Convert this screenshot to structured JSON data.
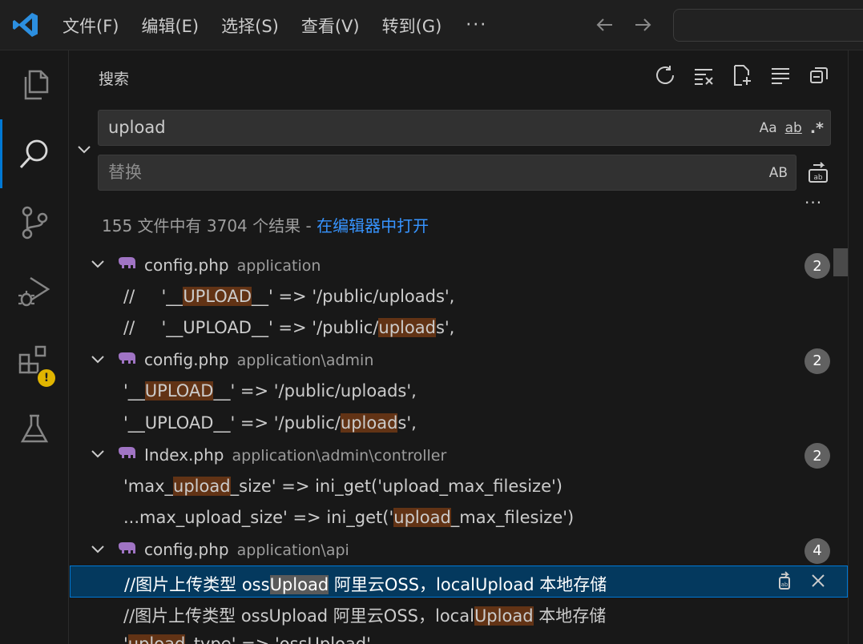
{
  "menu": {
    "items": [
      "文件(F)",
      "编辑(E)",
      "选择(S)",
      "查看(V)",
      "转到(G)"
    ],
    "more": "···"
  },
  "activity": {
    "items": [
      "files-icon",
      "search-icon",
      "source-control-icon",
      "run-debug-icon",
      "extensions-icon",
      "testing-icon"
    ],
    "warning_badge": "!"
  },
  "panel": {
    "title": "搜索",
    "search_value": "upload",
    "search_opts": [
      "Aa",
      "ab",
      ".*"
    ],
    "replace_placeholder": "替换",
    "replace_opt": "AB",
    "more": "···",
    "summary_text": "155 文件中有 3704 个结果 - ",
    "summary_link": "在编辑器中打开"
  },
  "results": [
    {
      "name": "config.php",
      "path": "application",
      "count": "2",
      "matches": [
        [
          "//     '__",
          "UPLOAD",
          "__' => '/public/uploads',"
        ],
        [
          "//     '__UPLOAD__' => '/public/",
          "upload",
          "s',"
        ]
      ]
    },
    {
      "name": "config.php",
      "path": "application\\admin",
      "count": "2",
      "matches": [
        [
          "'__",
          "UPLOAD",
          "__' => '/public/uploads',"
        ],
        [
          "'__UPLOAD__' => '/public/",
          "upload",
          "s',"
        ]
      ]
    },
    {
      "name": "Index.php",
      "path": "application\\admin\\controller",
      "count": "2",
      "matches": [
        [
          "'max_",
          "upload",
          "_size' => ini_get('upload_max_filesize')"
        ],
        [
          "...max_upload_size' => ini_get('",
          "upload",
          "_max_filesize')"
        ]
      ]
    },
    {
      "name": "config.php",
      "path": "application\\api",
      "count": "4",
      "matches": [
        [
          "//图片上传类型 oss",
          "Upload",
          " 阿里云OSS，localUpload 本地存储"
        ],
        [
          "//图片上传类型 ossUpload 阿里云OSS，local",
          "Upload",
          " 本地存储"
        ],
        [
          "'",
          "upload",
          "_type' => 'ossUpload',"
        ]
      ]
    }
  ],
  "colors": {
    "accent": "#0078d4",
    "link": "#3794ff",
    "match_highlight": "#623315",
    "selected_row": "#04395e",
    "warning": "#e1b500"
  }
}
